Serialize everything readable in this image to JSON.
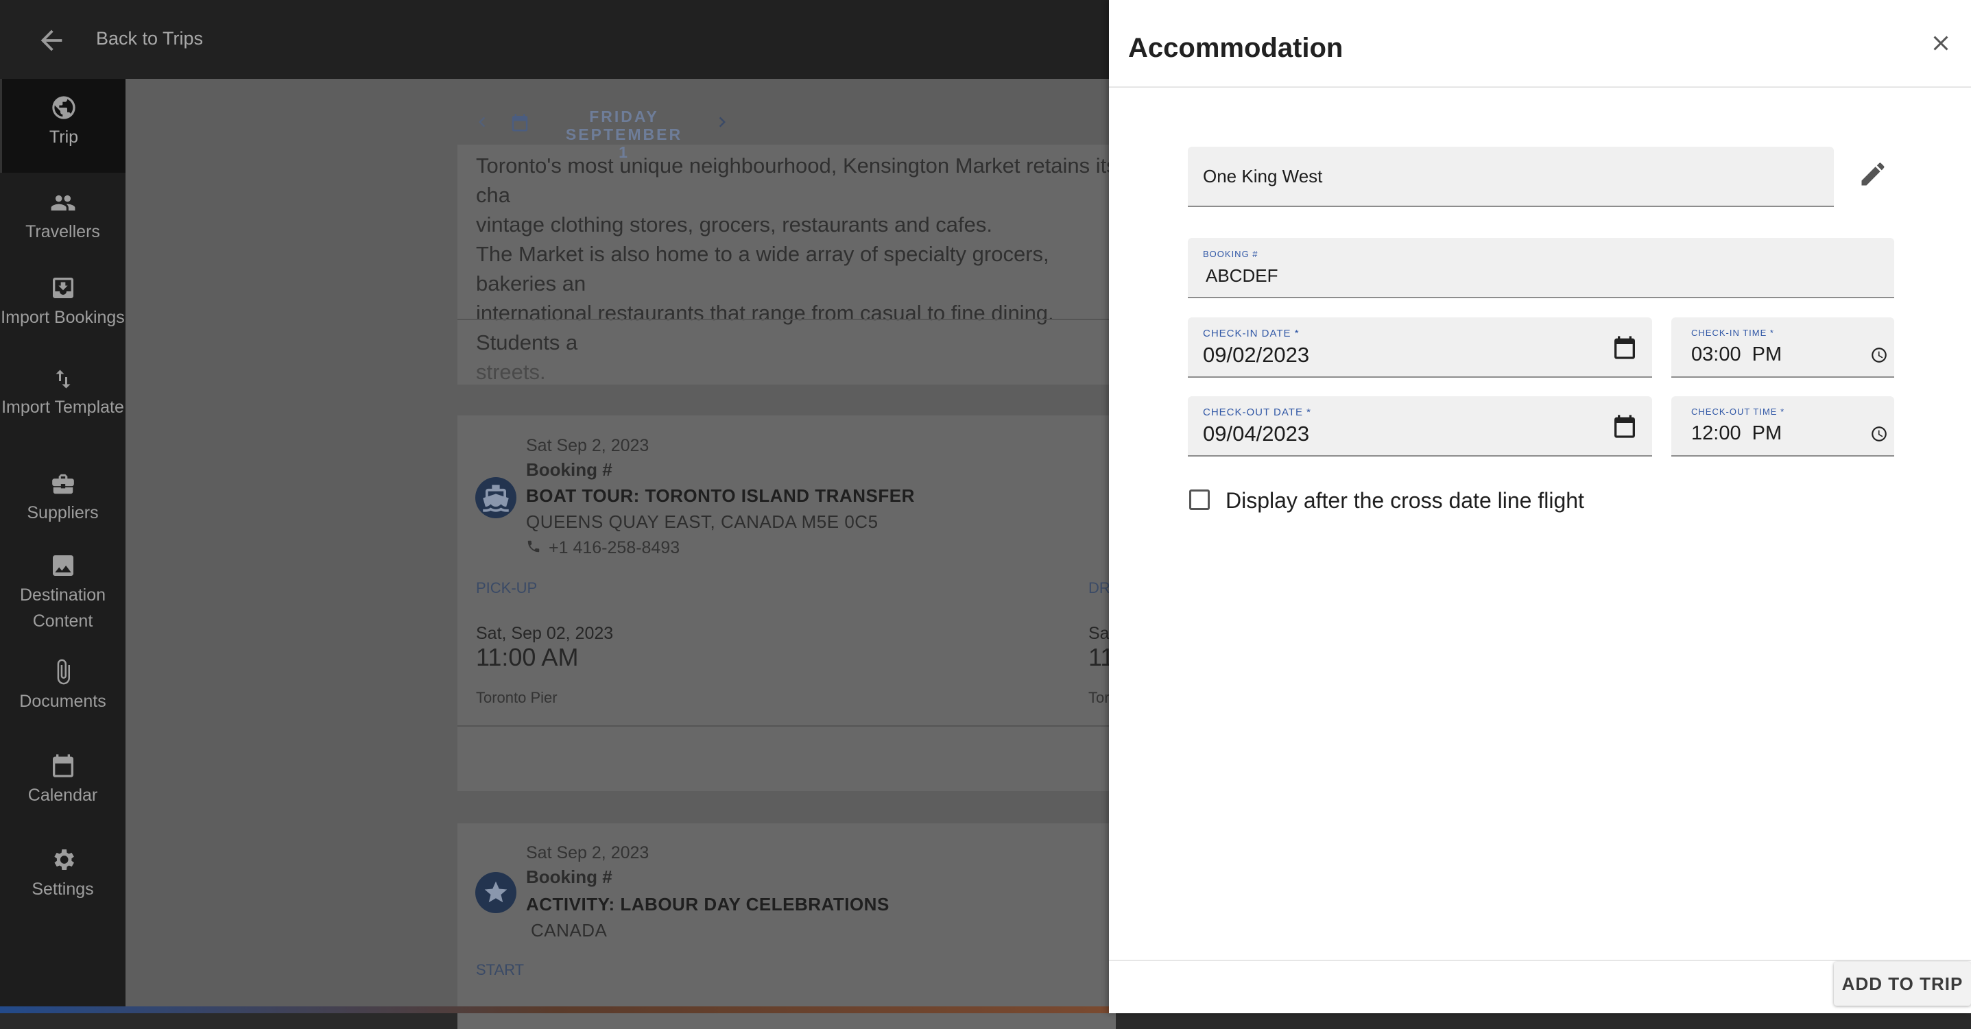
{
  "topbar": {
    "back_label": "Back to Trips"
  },
  "sidebar": {
    "items": [
      {
        "label": "Trip",
        "icon": "globe-icon"
      },
      {
        "label": "Travellers",
        "icon": "people-icon"
      },
      {
        "label": "Import Bookings",
        "icon": "import-icon"
      },
      {
        "label": "Import Template",
        "icon": "swap-vertical-icon"
      },
      {
        "label": "Suppliers",
        "icon": "briefcase-icon"
      },
      {
        "label": "Destination Content",
        "icon": "image-icon"
      },
      {
        "label": "Documents",
        "icon": "paperclip-icon"
      },
      {
        "label": "Calendar",
        "icon": "calendar-icon"
      },
      {
        "label": "Settings",
        "icon": "gear-icon"
      }
    ]
  },
  "date_nav": {
    "line1": "FRIDAY SEPTEMBER",
    "line2": "1"
  },
  "card1": {
    "lines": [
      "Toronto's most unique neighbourhood, Kensington Market retains its cha",
      "vintage clothing stores, grocers, restaurants and cafes.",
      "The Market is also home to a wide array of specialty grocers, bakeries an",
      "international restaurants that range from casual to fine dining. Students a",
      "streets."
    ]
  },
  "card2": {
    "date": "Sat Sep 2, 2023",
    "booking": "Booking #",
    "title": "BOAT TOUR: TORONTO ISLAND TRANSFER",
    "address": "QUEENS QUAY EAST, CANADA M5E 0C5",
    "phone": "+1 416-258-8493",
    "pickup_label": "PICK-UP",
    "pickup_date": "Sat, Sep 02, 2023",
    "pickup_time": "11:00 AM",
    "pickup_place": "Toronto Pier",
    "dropoff_label": "DR",
    "dropoff_date": "Sa",
    "dropoff_time": "11",
    "dropoff_place": "Tor"
  },
  "card3": {
    "date": "Sat Sep 2, 2023",
    "booking": "Booking #",
    "title": "ACTIVITY: LABOUR DAY CELEBRATIONS",
    "address": "CANADA",
    "start_label": "START"
  },
  "drawer": {
    "title": "Accommodation",
    "name_value": "One King West",
    "booking_label": "BOOKING #",
    "booking_value": "ABCDEF",
    "checkin_date_label": "CHECK-IN DATE *",
    "checkin_date_value": "09/02/2023",
    "checkin_time_label": "CHECK-IN TIME *",
    "checkin_time_value": "03:00  PM",
    "checkout_date_label": "CHECK-OUT DATE *",
    "checkout_date_value": "09/04/2023",
    "checkout_time_label": "CHECK-OUT TIME *",
    "checkout_time_value": "12:00  PM",
    "checkbox_label": "Display after the cross date line flight",
    "checkbox_checked": false,
    "add_button": "ADD TO TRIP"
  },
  "colors": {
    "accent": "#2f56a5",
    "sidebar_bg": "#1d1d1d",
    "topbar_bg": "#212121",
    "overlay_bg": "#5e5e5e",
    "boat_icon_bg": "#23344f"
  }
}
